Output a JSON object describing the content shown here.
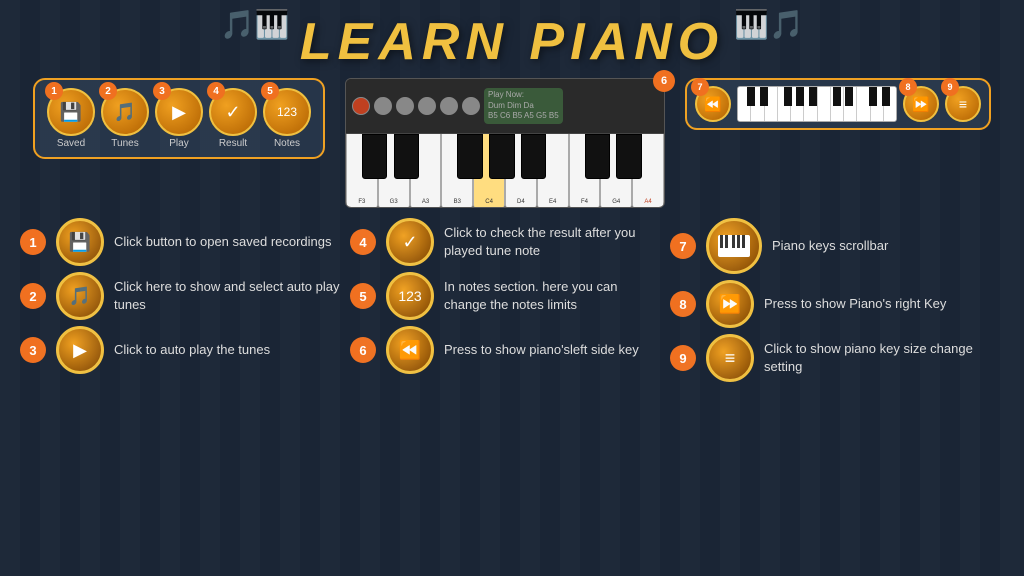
{
  "title": "LEARN PIANO",
  "music_note_left": "♩♪",
  "music_note_right": "♪♩",
  "toolbar": {
    "buttons": [
      {
        "num": "1",
        "icon": "💾",
        "label": "Saved"
      },
      {
        "num": "2",
        "icon": "🎵",
        "label": "Tunes"
      },
      {
        "num": "3",
        "icon": "▶",
        "label": "Play"
      },
      {
        "num": "4",
        "icon": "✓",
        "label": "Result"
      },
      {
        "num": "5",
        "icon": "123",
        "label": "Notes"
      }
    ]
  },
  "badge6_num": "6",
  "right_box_buttons": [
    {
      "num": "7",
      "type": "piano-scroll"
    },
    {
      "num": "8",
      "icon": "⏩"
    },
    {
      "num": "9",
      "icon": "≡"
    }
  ],
  "items_left": [
    {
      "num": "1",
      "icon": "💾",
      "title": "Click button to open saved recordings"
    },
    {
      "num": "2",
      "icon": "🎵",
      "title": "Click here to show and select  auto play tunes"
    },
    {
      "num": "3",
      "icon": "▶",
      "title": "Click to auto play the tunes"
    }
  ],
  "items_middle": [
    {
      "num": "4",
      "icon": "✓",
      "title": "Click to check the result after you played tune note"
    },
    {
      "num": "5",
      "icon": "123",
      "title": "In notes section. here you can change the notes limits"
    },
    {
      "num": "6",
      "icon": "⏪",
      "title": "Press to show piano'sleft side key"
    }
  ],
  "items_right": [
    {
      "num": "7",
      "type": "piano",
      "title": "Piano keys scrollbar"
    },
    {
      "num": "8",
      "icon": "⏩",
      "title": "Press to show Piano's right Key"
    },
    {
      "num": "9",
      "icon": "≡",
      "title": "Click to show  piano key size change setting"
    }
  ]
}
